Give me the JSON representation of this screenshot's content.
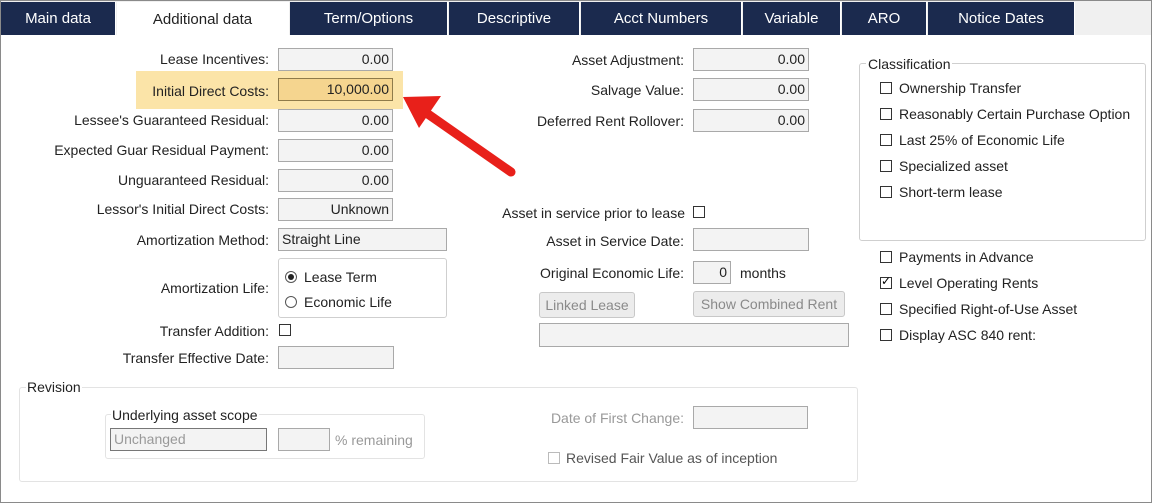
{
  "tabs": [
    {
      "label": "Main data"
    },
    {
      "label": "Additional data"
    },
    {
      "label": "Term/Options"
    },
    {
      "label": "Descriptive"
    },
    {
      "label": "Acct Numbers"
    },
    {
      "label": "Variable"
    },
    {
      "label": "ARO"
    },
    {
      "label": "Notice Dates"
    }
  ],
  "left": {
    "lease_incentives": {
      "label": "Lease Incentives:",
      "value": "0.00"
    },
    "initial_direct_costs": {
      "label": "Initial Direct Costs:",
      "value": "10,000.00"
    },
    "lessee_guaranteed_residual": {
      "label": "Lessee's Guaranteed Residual:",
      "value": "0.00"
    },
    "expected_guar_residual_payment": {
      "label": "Expected Guar Residual Payment:",
      "value": "0.00"
    },
    "unguaranteed_residual": {
      "label": "Unguaranteed Residual:",
      "value": "0.00"
    },
    "lessor_initial_direct_costs": {
      "label": "Lessor's Initial Direct Costs:",
      "value": "Unknown"
    },
    "amortization_method": {
      "label": "Amortization Method:",
      "value": "Straight Line"
    },
    "amortization_life": {
      "label": "Amortization Life:",
      "options": [
        "Lease Term",
        "Economic Life"
      ],
      "selected": "Lease Term"
    },
    "transfer_addition": {
      "label": "Transfer Addition:",
      "checked": false
    },
    "transfer_effective_date": {
      "label": "Transfer Effective Date:",
      "value": ""
    }
  },
  "middle": {
    "asset_adjustment": {
      "label": "Asset Adjustment:",
      "value": "0.00"
    },
    "salvage_value": {
      "label": "Salvage Value:",
      "value": "0.00"
    },
    "deferred_rent_rollover": {
      "label": "Deferred Rent Rollover:",
      "value": "0.00"
    },
    "asset_in_service_prior": {
      "label": "Asset in service prior to lease",
      "checked": false
    },
    "asset_in_service_date": {
      "label": "Asset in Service Date:",
      "value": ""
    },
    "original_economic_life": {
      "label": "Original Economic Life:",
      "value": "0",
      "unit": "months"
    },
    "linked_lease_button": "Linked Lease",
    "show_combined_rent_button": "Show Combined Rent",
    "linked_lease_value": ""
  },
  "classification": {
    "title": "Classification",
    "items": [
      {
        "label": "Ownership Transfer",
        "checked": false
      },
      {
        "label": "Reasonably Certain Purchase Option",
        "checked": false
      },
      {
        "label": "Last 25% of Economic Life",
        "checked": false
      },
      {
        "label": "Specialized asset",
        "checked": false
      },
      {
        "label": "Short-term lease",
        "checked": false
      }
    ]
  },
  "options": [
    {
      "label": "Payments in Advance",
      "checked": false
    },
    {
      "label": "Level Operating Rents",
      "checked": true
    },
    {
      "label": "Specified Right-of-Use Asset",
      "checked": false
    },
    {
      "label": "Display ASC 840 rent:",
      "checked": false
    }
  ],
  "revision": {
    "title": "Revision",
    "scope_title": "Underlying asset scope",
    "scope_value": "Unchanged",
    "percent_value": "",
    "percent_label": "% remaining",
    "date_first_change_label": "Date of First Change:",
    "date_first_change_value": "",
    "revised_fair_value_label": "Revised Fair Value as of inception",
    "revised_fair_value_checked": false
  },
  "annotation": {
    "arrow_color": "#e8201a",
    "highlight_color": "#fbe4a8"
  }
}
